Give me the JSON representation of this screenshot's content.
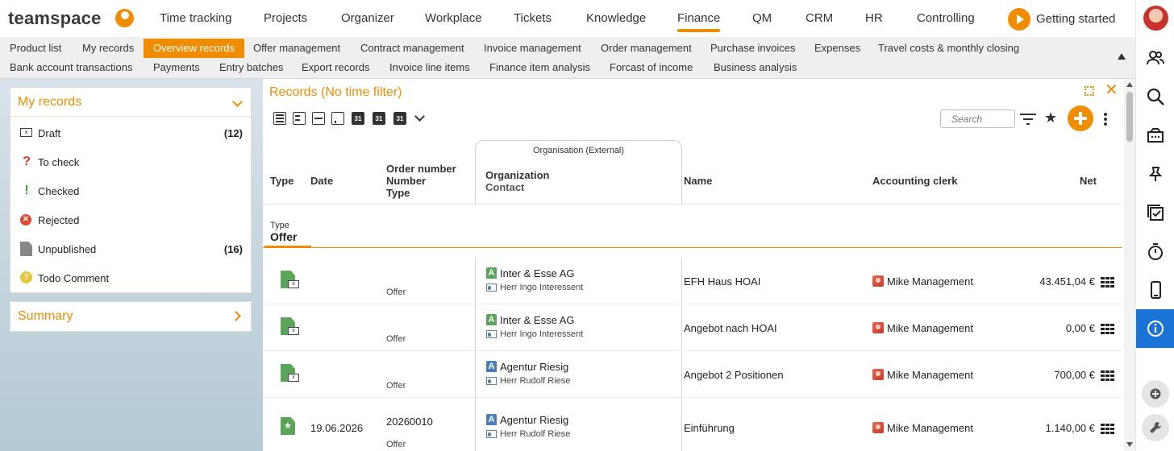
{
  "app": {
    "logo_text": "teamspace"
  },
  "topnav": {
    "items": [
      "Time tracking",
      "Projects",
      "Organizer",
      "Workplace",
      "Tickets",
      "Knowledge",
      "Finance",
      "QM",
      "CRM",
      "HR",
      "Controlling"
    ],
    "active": "Finance",
    "getting_started": "Getting started"
  },
  "subnav": {
    "row1": [
      "Product list",
      "My records",
      "Overview records",
      "Offer management",
      "Contract management",
      "Invoice management",
      "Order management",
      "Purchase invoices",
      "Expenses",
      "Travel costs & monthly closing"
    ],
    "row2": [
      "Bank account transactions",
      "Payments",
      "Entry batches",
      "Export records",
      "Invoice line items",
      "Finance item analysis",
      "Forcast of income",
      "Business analysis"
    ],
    "active": "Overview records"
  },
  "my_records": {
    "title": "My records",
    "items": [
      {
        "label": "Draft",
        "count": "(12)",
        "icon": "draft-icon"
      },
      {
        "label": "To check",
        "count": "",
        "icon": "question-icon"
      },
      {
        "label": "Checked",
        "count": "",
        "icon": "exclamation-icon"
      },
      {
        "label": "Rejected",
        "count": "",
        "icon": "rejected-icon"
      },
      {
        "label": "Unpublished",
        "count": "(16)",
        "icon": "document-icon"
      },
      {
        "label": "Todo Comment",
        "count": "",
        "icon": "bulb-icon"
      }
    ]
  },
  "summary": {
    "title": "Summary"
  },
  "panel": {
    "title": "Records (No time filter)",
    "search_placeholder": "Search"
  },
  "table": {
    "group_header": "Organisation (External)",
    "headers": {
      "type": "Type",
      "date": "Date",
      "order_number": "Order number",
      "number": "Number",
      "order_type": "Type",
      "organization": "Organization",
      "contact": "Contact",
      "name": "Name",
      "clerk": "Accounting clerk",
      "net": "Net"
    },
    "group": {
      "label": "Type",
      "value": "Offer"
    },
    "rows": [
      {
        "date": "",
        "order_number": "",
        "type": "Offer",
        "org_badge": "A",
        "org_color": "#5aa55a",
        "organization": "Inter & Esse AG",
        "contact": "Herr Ingo Interessent",
        "name": "EFH Haus HOAI",
        "clerk": "Mike Management",
        "net": "43.451,04 €"
      },
      {
        "date": "",
        "order_number": "",
        "type": "Offer",
        "org_badge": "A",
        "org_color": "#5aa55a",
        "organization": "Inter & Esse AG",
        "contact": "Herr Ingo Interessent",
        "name": "Angebot nach HOAI",
        "clerk": "Mike Management",
        "net": "0,00 €"
      },
      {
        "date": "",
        "order_number": "",
        "type": "Offer",
        "org_badge": "A",
        "org_color": "#4a7fb5",
        "organization": "Agentur Riesig",
        "contact": "Herr Rudolf Riese",
        "name": "Angebot 2 Positionen",
        "clerk": "Mike Management",
        "net": "700,00 €"
      },
      {
        "date": "19.06.2026",
        "order_number": "20260010",
        "type": "Offer",
        "org_badge": "A",
        "org_color": "#4a7fb5",
        "organization": "Agentur Riesig",
        "contact": "Herr Rudolf Riese",
        "name": "Einführung",
        "clerk": "Mike Management",
        "net": "1.140,00 €"
      }
    ]
  },
  "colors": {
    "accent": "#f08c00",
    "info_active": "#1b73d6",
    "doc_green": "#5aa55a"
  }
}
